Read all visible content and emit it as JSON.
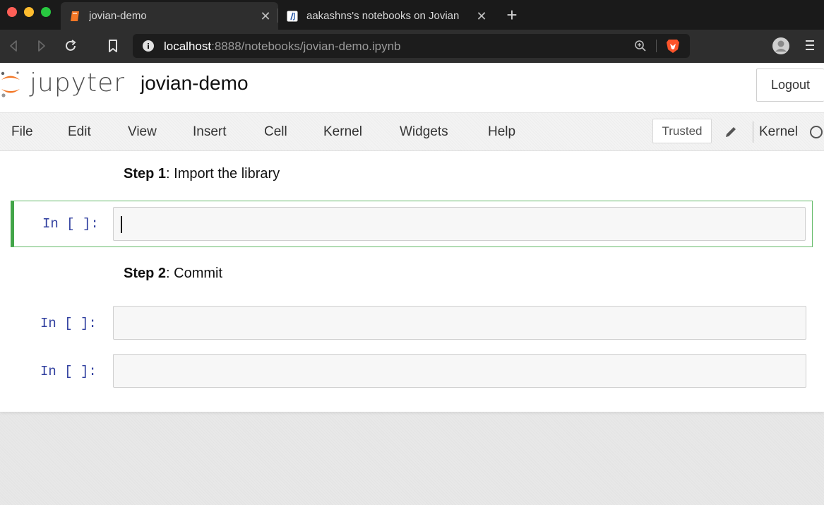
{
  "browser": {
    "tabs": [
      {
        "label": "jovian-demo",
        "active": true,
        "icon": "notebook-favicon-icon"
      },
      {
        "label": "aakashns's notebooks on Jovian",
        "active": false,
        "icon": "jovian-favicon-icon"
      }
    ],
    "url_host": "localhost",
    "url_rest": ":8888/notebooks/jovian-demo.ipynb"
  },
  "jupyter": {
    "wordmark": "jupyter",
    "notebook_name": "jovian-demo",
    "logout_label": "Logout",
    "menu": [
      "File",
      "Edit",
      "View",
      "Insert",
      "Cell",
      "Kernel",
      "Widgets",
      "Help"
    ],
    "trusted_label": "Trusted",
    "kernel_label": "Kernel"
  },
  "cells": {
    "md1_bold": "Step 1",
    "md1_rest": ": Import the library",
    "md2_bold": "Step 2",
    "md2_rest": ": Commit",
    "prompt1": "In [ ]:",
    "prompt2": "In [ ]:",
    "prompt3": "In [ ]:"
  },
  "colors": {
    "jupyter_orange": "#f37726",
    "prompt_blue": "#303f9f",
    "selected_cell_green": "#42a548"
  }
}
